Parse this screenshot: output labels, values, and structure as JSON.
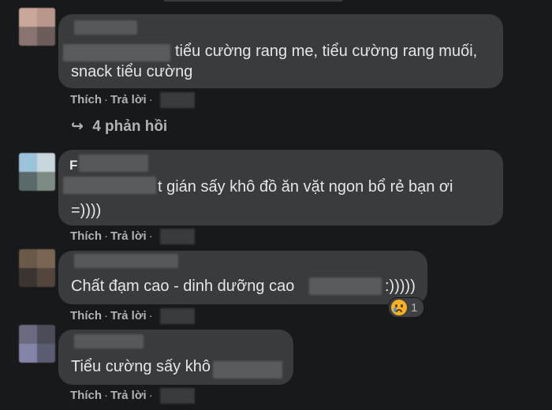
{
  "comments": [
    {
      "text_line1": "tiểu cường rang me, tiểu cường rang muối,",
      "text_line2": "snack tiểu cường",
      "like": "Thích",
      "reply": "Trả lời",
      "replies_label": "4 phản hồi"
    },
    {
      "name_visible": "F",
      "text_line1": "t gián sấy khô đồ ăn vặt ngon bổ rẻ bạn ơi",
      "text_line2": "=))))",
      "like": "Thích",
      "reply": "Trả lời"
    },
    {
      "text_line1": "Chất đạm cao - dinh dưỡng cao",
      "text_suffix": ":)))))",
      "like": "Thích",
      "reply": "Trả lời",
      "reaction_count": "1",
      "reaction_icon": "sad-face-icon"
    },
    {
      "text_line1": "Tiểu cường sấy khô",
      "like": "Thích",
      "reply": "Trả lời"
    }
  ],
  "icons": {
    "reply_arrow": "↪"
  },
  "colors": {
    "background": "#18191a",
    "bubble": "#3a3b3c",
    "secondary_text": "#b0b3b8"
  }
}
